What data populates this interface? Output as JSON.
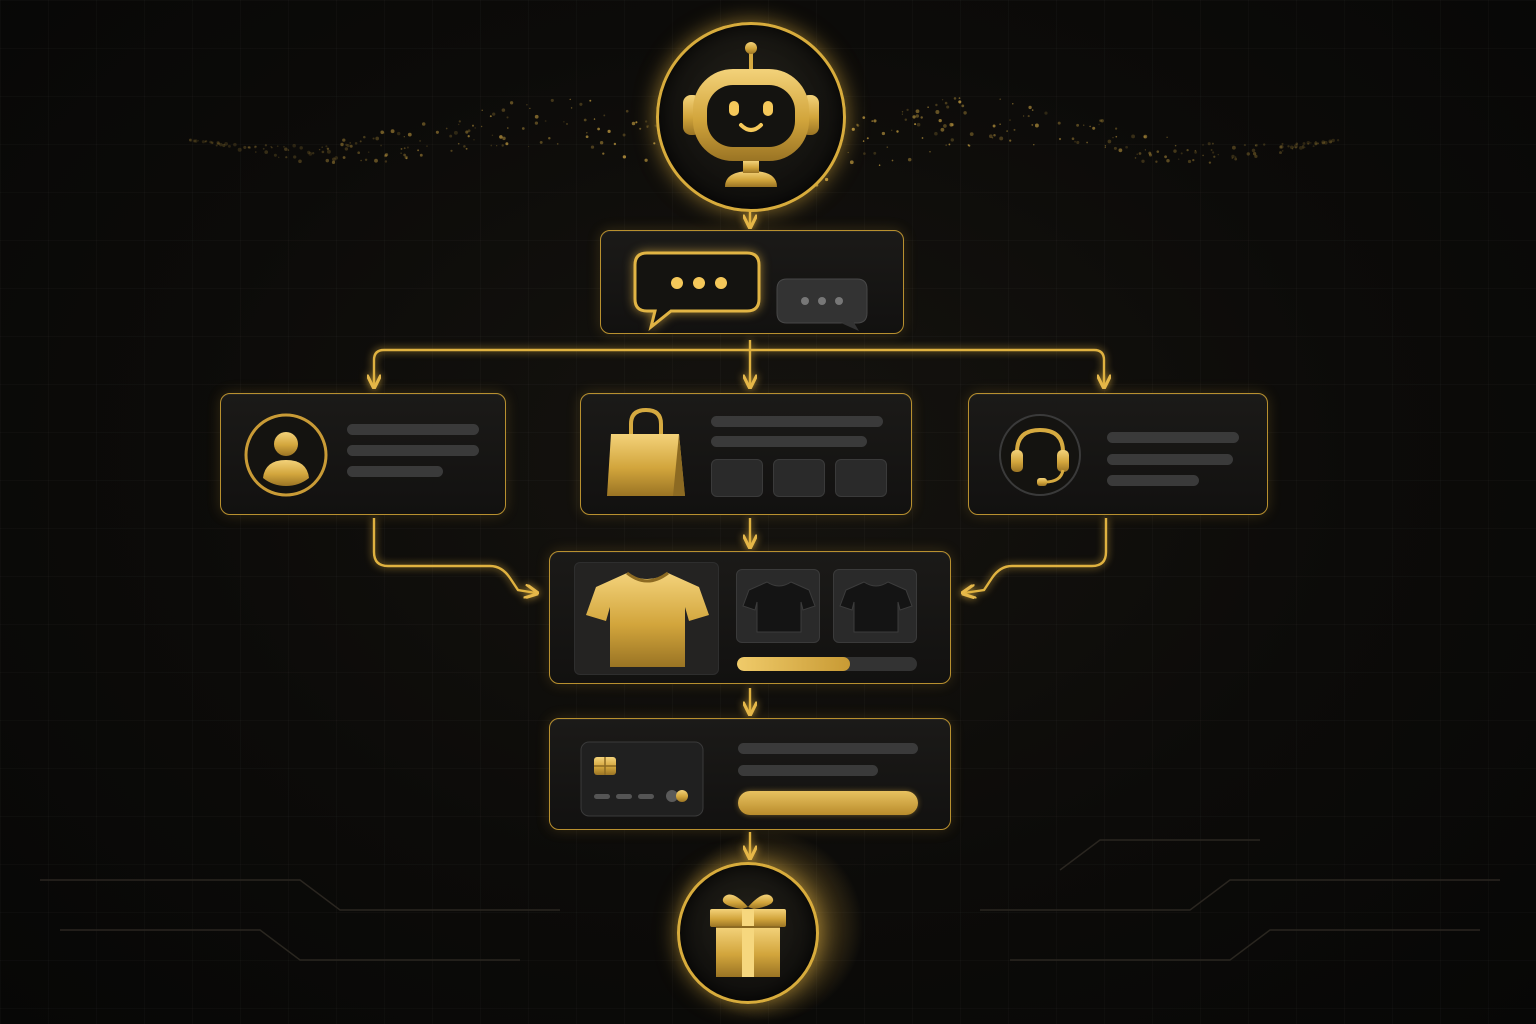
{
  "colors": {
    "accent": "#d8ac3c",
    "background": "#0c0b09",
    "card": "#151412",
    "placeholder": "#3a3a3a"
  },
  "nodes": {
    "start": {
      "icon": "robot-chatbot-icon"
    },
    "chat": {
      "icons": [
        "chat-bubble-icon",
        "typing-bubble-icon"
      ]
    },
    "account": {
      "icon": "user-avatar-icon"
    },
    "shopping": {
      "icon": "shopping-bag-icon"
    },
    "support": {
      "icon": "headset-icon"
    },
    "product": {
      "icons": [
        "gold-tshirt-icon",
        "black-tshirt-icon",
        "black-tshirt-icon"
      ],
      "progress": 0.63
    },
    "payment": {
      "icon": "credit-card-icon"
    },
    "end": {
      "icon": "gift-box-icon"
    }
  }
}
